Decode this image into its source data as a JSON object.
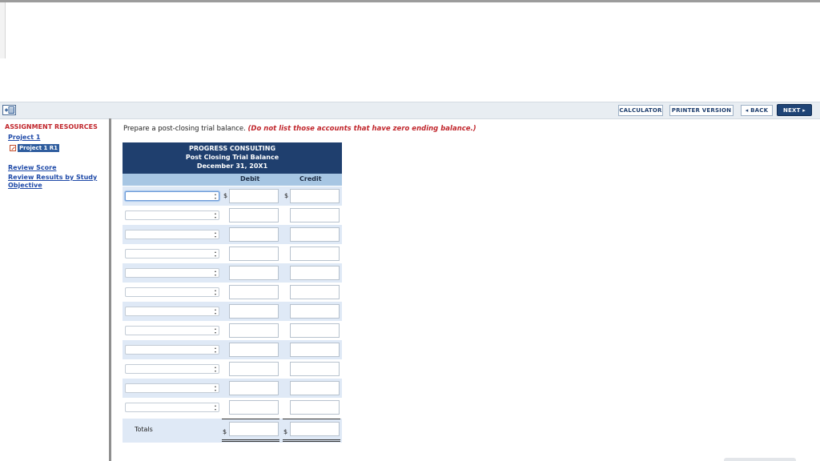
{
  "toolbar": {
    "calculator": "CALCULATOR",
    "printer_version": "PRINTER VERSION",
    "back": "◂ BACK",
    "next": "NEXT ▸"
  },
  "sidebar": {
    "title": "ASSIGNMENT RESOURCES",
    "project": "Project 1",
    "selected_item": "Project 1 R1",
    "review_score": "Review Score",
    "review_results": "Review Results by Study Objective"
  },
  "instructions": {
    "text": "Prepare a post-closing trial balance.",
    "note": "(Do not list those accounts that have zero ending balance.)"
  },
  "table": {
    "company": "PROGRESS CONSULTING",
    "statement": "Post Closing Trial Balance",
    "date": "December 31, 20X1",
    "col_debit": "Debit",
    "col_credit": "Credit",
    "currency_symbol": "$",
    "totals_label": "Totals",
    "rows": [
      {
        "account": "",
        "debit": "",
        "credit": ""
      },
      {
        "account": "",
        "debit": "",
        "credit": ""
      },
      {
        "account": "",
        "debit": "",
        "credit": ""
      },
      {
        "account": "",
        "debit": "",
        "credit": ""
      },
      {
        "account": "",
        "debit": "",
        "credit": ""
      },
      {
        "account": "",
        "debit": "",
        "credit": ""
      },
      {
        "account": "",
        "debit": "",
        "credit": ""
      },
      {
        "account": "",
        "debit": "",
        "credit": ""
      },
      {
        "account": "",
        "debit": "",
        "credit": ""
      },
      {
        "account": "",
        "debit": "",
        "credit": ""
      },
      {
        "account": "",
        "debit": "",
        "credit": ""
      },
      {
        "account": "",
        "debit": "",
        "credit": ""
      }
    ],
    "total_debit": "",
    "total_credit": ""
  },
  "colors": {
    "header_navy": "#1f3f6e",
    "column_header_blue": "#a7c6e3",
    "row_alt": "#dfe9f6",
    "accent_red": "#c1272d",
    "link_blue": "#1f4aa8"
  }
}
